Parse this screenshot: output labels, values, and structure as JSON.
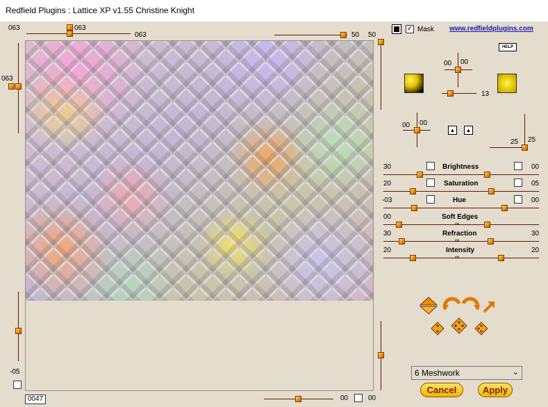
{
  "window": {
    "title": "Redfield Plugins : Lattice XP v1.55   Christine Knight"
  },
  "left_panel": {
    "top_slider_a_value": "063",
    "top_slider_b_value": "063",
    "top_slider_c_value": "063",
    "right_slider_value_a": "50",
    "right_slider_value_b": "50",
    "left_vertical_value": "063",
    "left_bottom_value": "-05",
    "preview_counter": "0047",
    "bottom_right_value_a": "00",
    "bottom_right_value_b": "00"
  },
  "right_panel": {
    "mask_label": "Mask",
    "website_link": "www.redfieldplugins.com",
    "help_label": "HELP",
    "crosshair_a_values": [
      "00",
      "00"
    ],
    "crosshair_b_values": [
      "00",
      "00"
    ],
    "light_size_value": "13",
    "depth_values": [
      "25",
      "25"
    ],
    "adjustments": [
      {
        "label": "Brightness",
        "left": "30",
        "right": "00"
      },
      {
        "label": "Saturation",
        "left": "20",
        "right": "05"
      },
      {
        "label": "Hue",
        "left": "-03",
        "right": "00"
      },
      {
        "label": "Soft Edges",
        "left": "00",
        "right": ""
      },
      {
        "label": "Refraction",
        "left": "30",
        "right": "30"
      },
      {
        "label": "Intensity",
        "left": "20",
        "right": "20"
      }
    ],
    "preset": {
      "selected": "6 Meshwork"
    },
    "cancel_label": "Cancel",
    "apply_label": "Apply"
  },
  "colors": {
    "accent": "#f08a00",
    "link": "#1a1ab0",
    "panel_bg": "#e4dccd"
  }
}
